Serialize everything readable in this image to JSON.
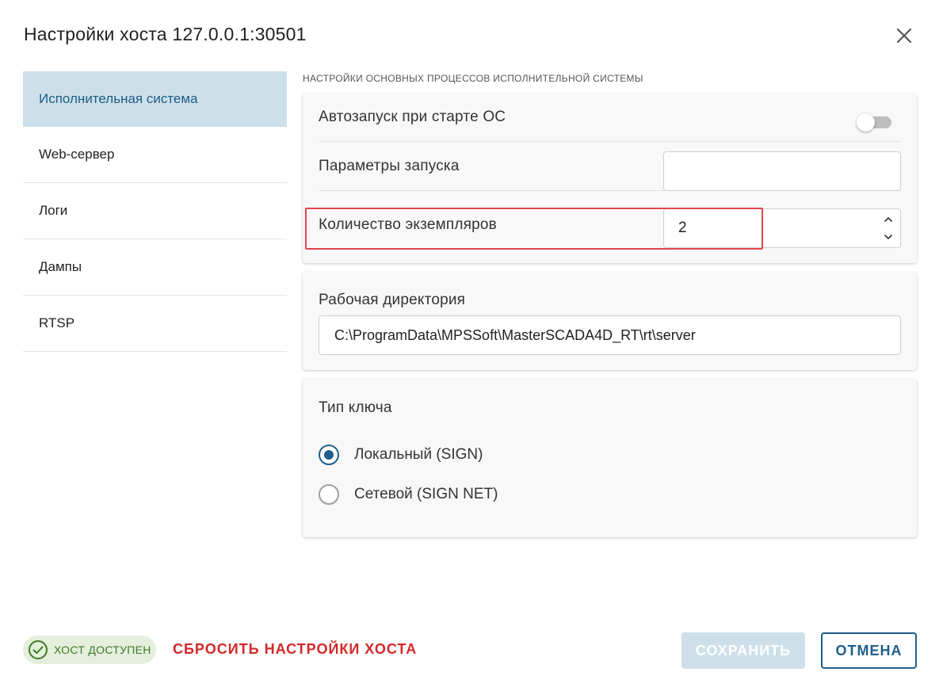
{
  "dialog": {
    "title": "Настройки хоста 127.0.0.1:30501"
  },
  "sidebar": {
    "items": [
      {
        "label": "Исполнительная система",
        "active": true
      },
      {
        "label": "Web-сервер",
        "active": false
      },
      {
        "label": "Логи",
        "active": false
      },
      {
        "label": "Дампы",
        "active": false
      },
      {
        "label": "RTSP",
        "active": false
      }
    ]
  },
  "main": {
    "section_caption": "НАСТРОЙКИ ОСНОВНЫХ ПРОЦЕССОВ ИСПОЛНИТЕЛЬНОЙ СИСТЕМЫ",
    "autostart": {
      "label": "Автозапуск при старте ОС",
      "enabled": false
    },
    "launch_params": {
      "label": "Параметры запуска",
      "value": ""
    },
    "instance_count": {
      "label": "Количество экземпляров",
      "value": "2"
    },
    "work_dir": {
      "label": "Рабочая директория",
      "value": "C:\\ProgramData\\MPSSoft\\MasterSCADA4D_RT\\rt\\server"
    },
    "key_type": {
      "label": "Тип ключа",
      "options": [
        {
          "label": "Локальный (SIGN)",
          "checked": true
        },
        {
          "label": "Сетевой (SIGN NET)",
          "checked": false
        }
      ]
    }
  },
  "footer": {
    "status": "ХОСТ ДОСТУПЕН",
    "reset_label": "СБРОСИТЬ НАСТРОЙКИ ХОСТА",
    "save_label": "СОХРАНИТЬ",
    "cancel_label": "ОТМЕНА"
  },
  "colors": {
    "accent": "#1f5e8a",
    "active_bg": "#cde0ea",
    "danger": "#d42727",
    "success": "#3d7a27",
    "highlight": "#e4454e"
  },
  "icons": {
    "close": "close-icon",
    "status": "check-circle-icon",
    "spinner": "chevron-up-down-icon"
  }
}
